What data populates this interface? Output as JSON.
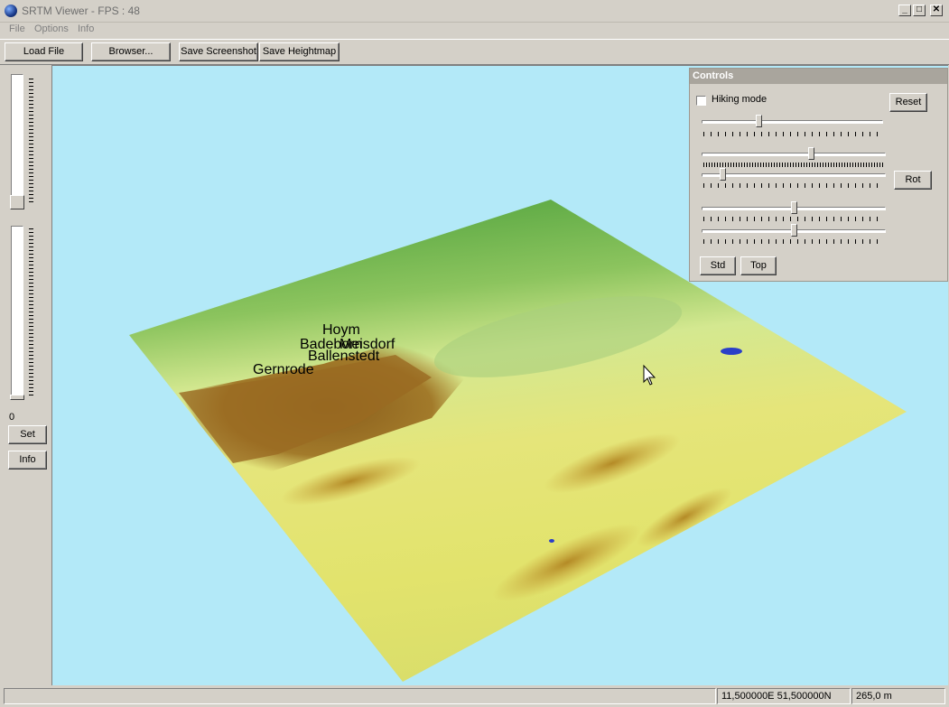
{
  "window": {
    "title": "SRTM Viewer - FPS : 48",
    "icon": "globe-icon",
    "controls": {
      "minimize": "_",
      "maximize": "□",
      "close": "✕"
    }
  },
  "menubar": {
    "items": [
      "File",
      "Options",
      "Info"
    ]
  },
  "toolbar": {
    "load_file": "Load File",
    "browser": "Browser...",
    "save_screenshot": "Save Screenshot",
    "save_heightmap": "Save Heightmap"
  },
  "left_panel": {
    "value": "0",
    "set_label": "Set",
    "info_label": "Info"
  },
  "controls_panel": {
    "title": "Controls",
    "hiking_mode_label": "Hiking mode",
    "hiking_mode_checked": false,
    "reset_label": "Reset",
    "rot_label": "Rot",
    "std_label": "Std",
    "top_label": "Top",
    "slider_levels": [
      0.31,
      0.6,
      0.1,
      0.5,
      0.5
    ]
  },
  "map": {
    "place_labels": [
      "Hoym",
      "Badeborn",
      "Meisdorf",
      "Ballenstedt",
      "Gernrode"
    ],
    "sky_color": "#b3e9f8"
  },
  "statusbar": {
    "empty": "",
    "coordinates": "11,500000E  51,500000N",
    "elevation": "265,0 m"
  }
}
